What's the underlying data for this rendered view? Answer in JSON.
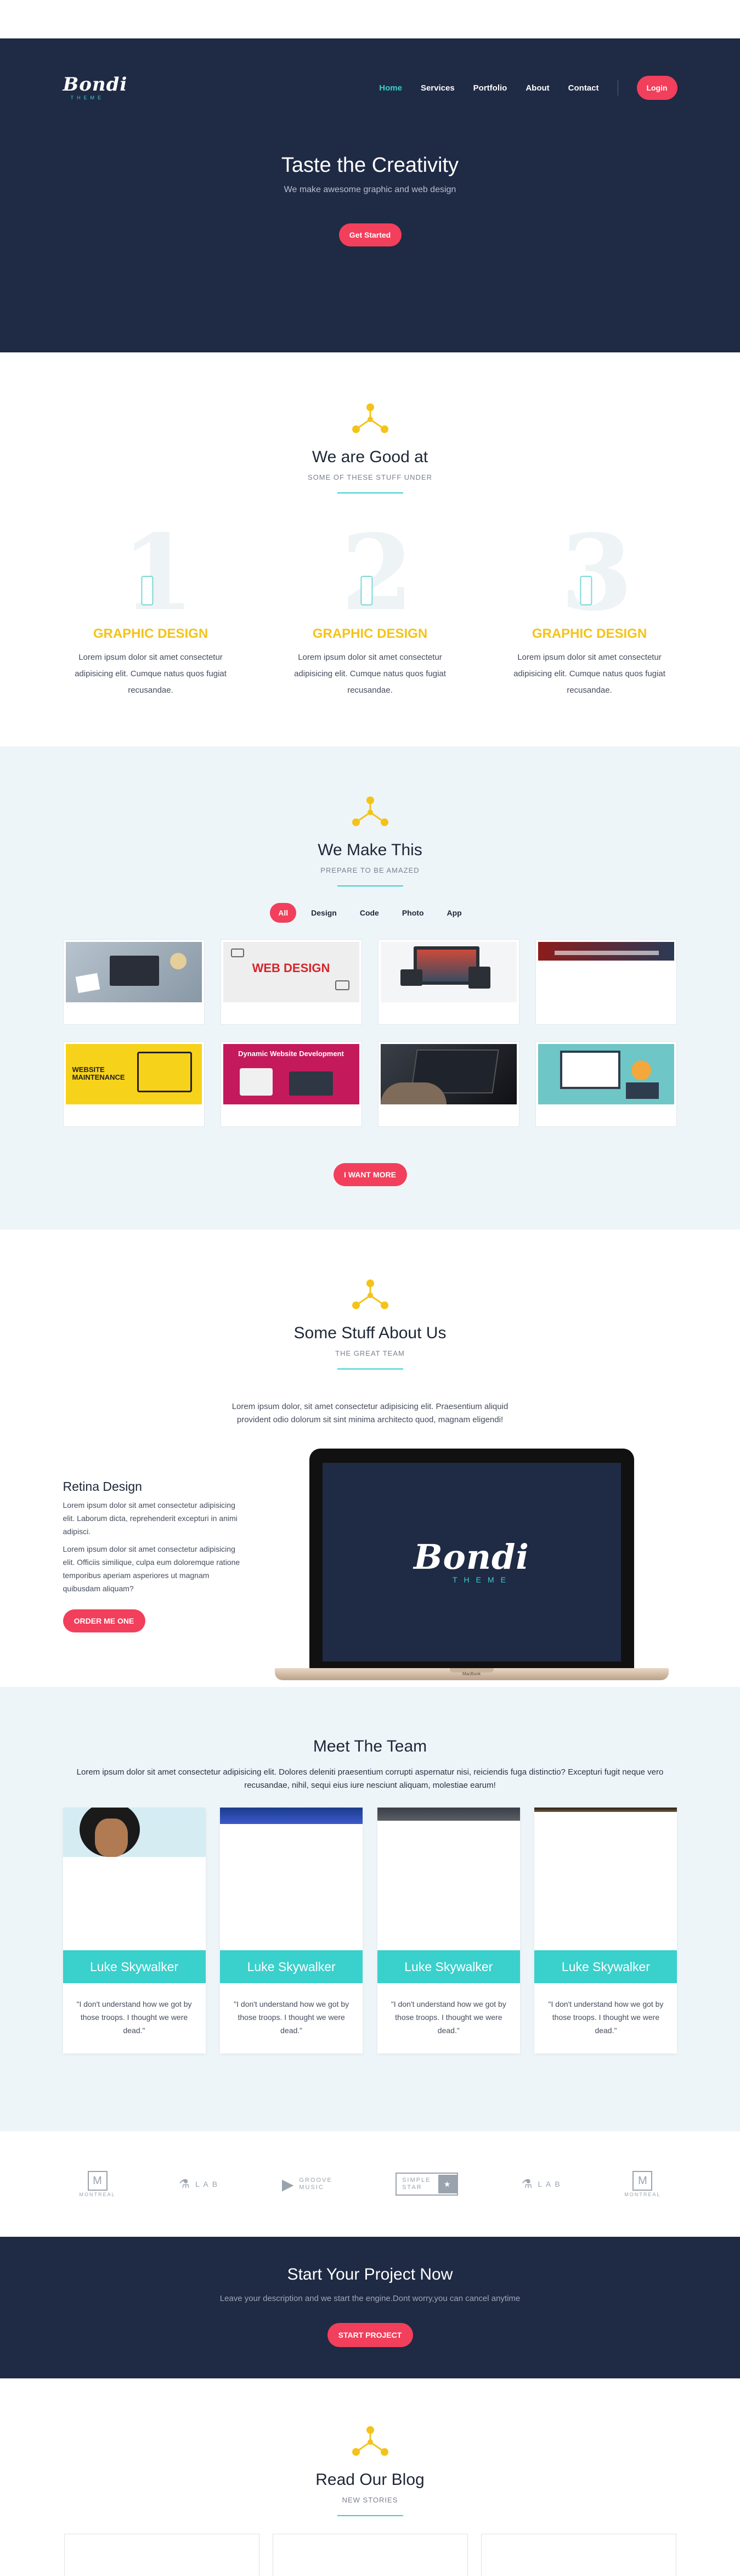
{
  "brand": {
    "name": "Bondi",
    "tagline": "THEME"
  },
  "nav": {
    "items": [
      "Home",
      "Services",
      "Portfolio",
      "About",
      "Contact"
    ],
    "login": "Login"
  },
  "hero": {
    "title": "Taste the Creativity",
    "subtitle": "We make awesome graphic and web design",
    "cta": "Get Started"
  },
  "good": {
    "title": "We are Good at",
    "subtitle": "SOME OF THESE STUFF UNDER",
    "features": [
      {
        "num": "1",
        "title": "GRAPHIC DESIGN",
        "text": "Lorem ipsum dolor sit amet consectetur adipisicing elit. Cumque natus quos fugiat recusandae."
      },
      {
        "num": "2",
        "title": "GRAPHIC DESIGN",
        "text": "Lorem ipsum dolor sit amet consectetur adipisicing elit. Cumque natus quos fugiat recusandae."
      },
      {
        "num": "3",
        "title": "GRAPHIC DESIGN",
        "text": "Lorem ipsum dolor sit amet consectetur adipisicing elit. Cumque natus quos fugiat recusandae."
      }
    ]
  },
  "make": {
    "title": "We Make This",
    "subtitle": "PREPARE TO BE AMAZED",
    "filters": [
      "All",
      "Design",
      "Code",
      "Photo",
      "App"
    ],
    "thumb_texts": {
      "web_design": "WEB DESIGN",
      "maintenance": "WEBSITE MAINTENANCE",
      "dynamic": "Dynamic Website Development"
    },
    "more": "I WANT MORE"
  },
  "about": {
    "title": "Some Stuff About Us",
    "subtitle": "THE GREAT TEAM",
    "intro": "Lorem ipsum dolor, sit amet consectetur adipisicing elit. Praesentium aliquid provident odio dolorum sit sint minima architecto quod, magnam eligendi!",
    "heading": "Retina Design",
    "p1": "Lorem ipsum dolor sit amet consectetur adipisicing elit. Laborum dicta, reprehenderit excepturi in animi adipisci.",
    "p2": "Lorem ipsum dolor sit amet consectetur adipisicing elit. Officiis similique, culpa eum doloremque ratione temporibus aperiam asperiores ut magnam quibusdam aliquam?",
    "order": "ORDER ME ONE",
    "laptop_model": "MacBook"
  },
  "team": {
    "title": "Meet The Team",
    "desc": "Lorem ipsum dolor sit amet consectetur adipisicing elit. Dolores deleniti praesentium corrupti aspernatur nisi, reiciendis fuga distinctio? Excepturi fugit neque vero recusandae, nihil, sequi eius iure nesciunt aliquam, molestiae earum!",
    "members": [
      {
        "name": "Luke Skywalker",
        "quote": "\"I don't understand how we got by those troops. I thought we were dead.\""
      },
      {
        "name": "Luke Skywalker",
        "quote": "\"I don't understand how we got by those troops. I thought we were dead.\""
      },
      {
        "name": "Luke Skywalker",
        "quote": "\"I don't understand how we got by those troops. I thought we were dead.\""
      },
      {
        "name": "Luke Skywalker",
        "quote": "\"I don't understand how we got by those troops. I thought we were dead.\""
      }
    ]
  },
  "clients": {
    "montreal": "MONTREAL",
    "lab": "L A B",
    "groove": "GROOVE MUSIC",
    "simple_star": "SIMPLE STAR",
    "m": "M"
  },
  "cta": {
    "title": "Start Your Project Now",
    "text": "Leave your description and we start the engine.Dont worry,you can cancel anytime",
    "button": "START PROJECT"
  },
  "blog": {
    "title": "Read Our Blog",
    "subtitle": "NEW STORIES"
  },
  "colors": {
    "navy": "#1f2a44",
    "teal": "#3ad0cc",
    "coral": "#f23f5b",
    "yellow": "#f4c31a",
    "light": "#eef5f9"
  }
}
